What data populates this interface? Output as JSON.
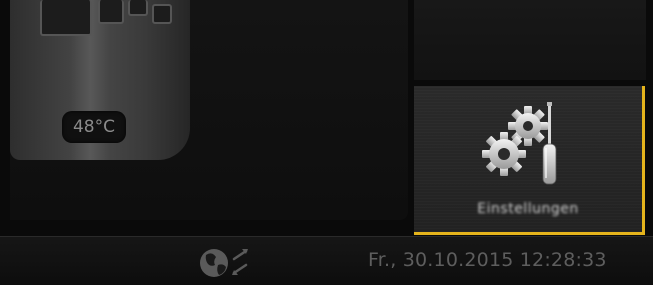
{
  "tank": {
    "temperature": "48°C"
  },
  "settings_tile": {
    "label": "Einstellungen",
    "icon": "gears-screwdriver-icon",
    "highlight_color": "#e5b41c"
  },
  "status_bar": {
    "network_icon": "globe-arrows-icon",
    "datetime": "Fr., 30.10.2015 12:28:33"
  }
}
